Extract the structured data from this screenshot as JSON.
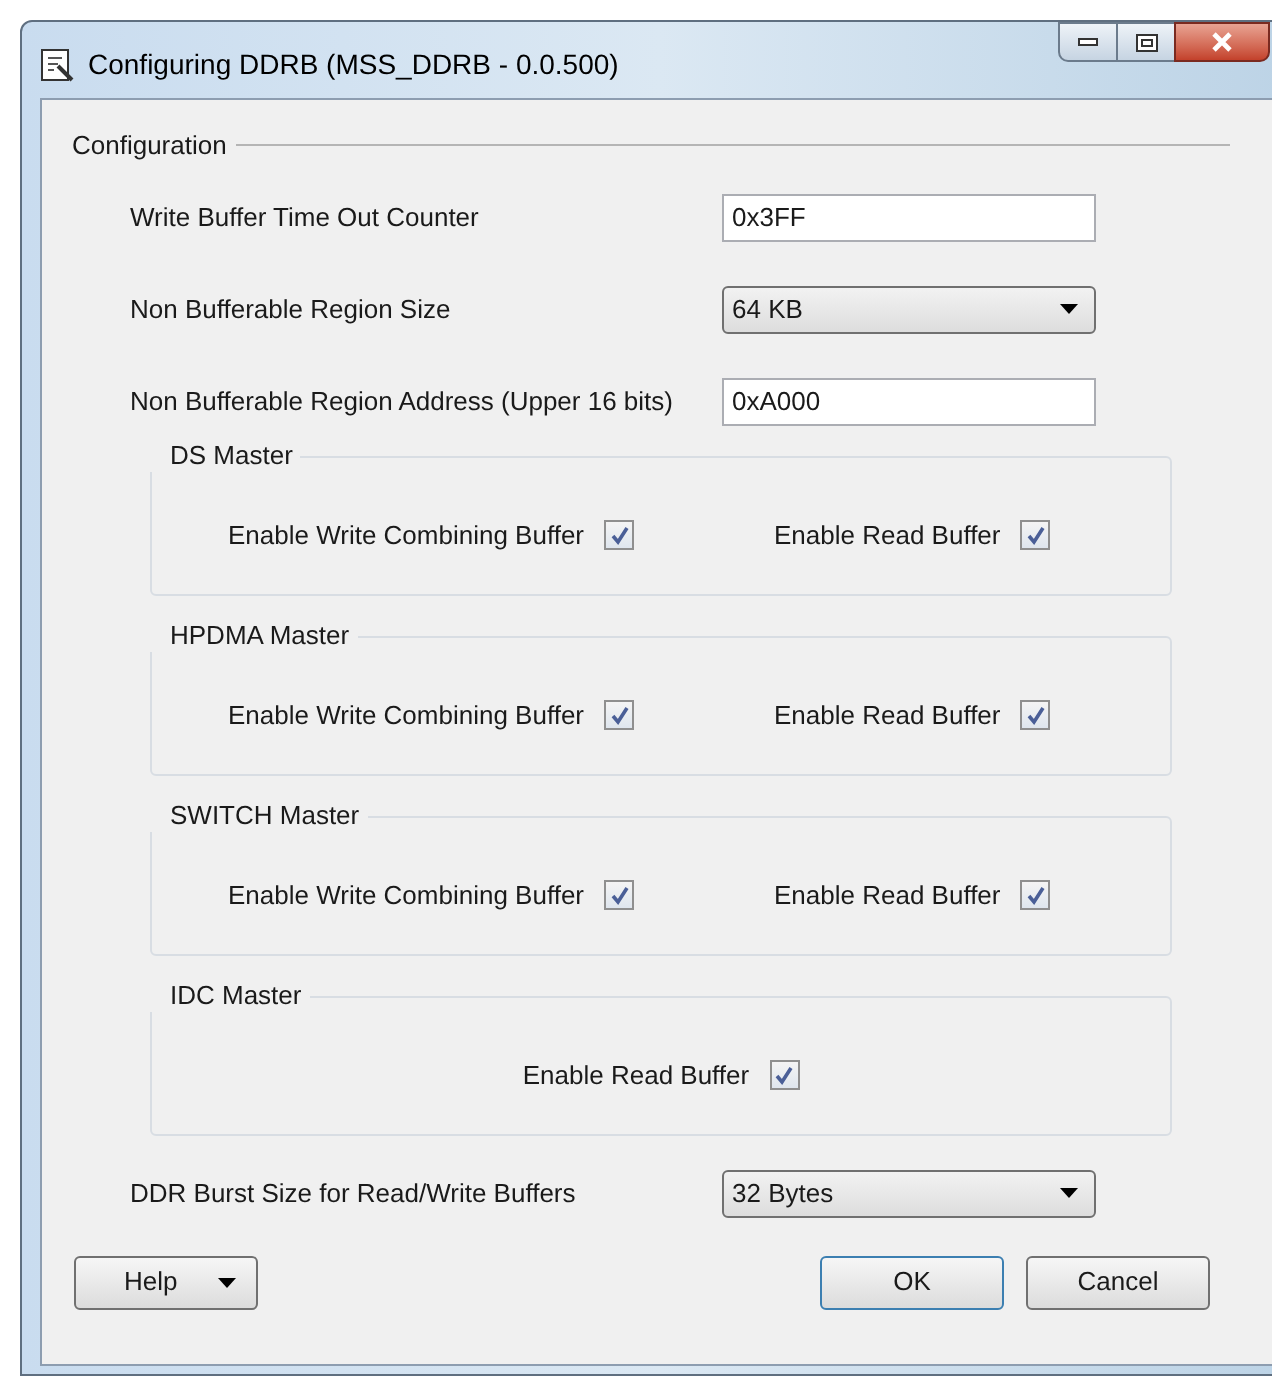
{
  "window": {
    "title": "Configuring DDRB (MSS_DDRB - 0.0.500)"
  },
  "configuration": {
    "title": "Configuration",
    "fields": [
      {
        "label": "Write Buffer Time Out Counter",
        "kind": "text",
        "value": "0x3FF"
      },
      {
        "label": "Non Bufferable Region Size",
        "kind": "select",
        "value": "64 KB"
      },
      {
        "label": "Non Bufferable Region Address (Upper 16 bits)",
        "kind": "text",
        "value": "0xA000"
      }
    ],
    "masters": [
      {
        "title": "DS Master",
        "checkboxes": [
          {
            "label": "Enable Write Combining Buffer",
            "checked": true
          },
          {
            "label": "Enable Read Buffer",
            "checked": true
          }
        ]
      },
      {
        "title": "HPDMA Master",
        "checkboxes": [
          {
            "label": "Enable Write Combining Buffer",
            "checked": true
          },
          {
            "label": "Enable Read Buffer",
            "checked": true
          }
        ]
      },
      {
        "title": "SWITCH Master",
        "checkboxes": [
          {
            "label": "Enable Write Combining Buffer",
            "checked": true
          },
          {
            "label": "Enable Read Buffer",
            "checked": true
          }
        ]
      },
      {
        "title": "IDC Master",
        "checkboxes": [
          {
            "label": "Enable Read Buffer",
            "checked": true
          }
        ]
      }
    ],
    "burst": {
      "label": "DDR Burst Size for Read/Write Buffers",
      "kind": "select",
      "value": "32 Bytes"
    }
  },
  "buttons": [
    {
      "label": "Help",
      "kind": "menu"
    },
    {
      "label": "OK",
      "kind": "default"
    },
    {
      "label": "Cancel",
      "kind": "plain"
    }
  ]
}
